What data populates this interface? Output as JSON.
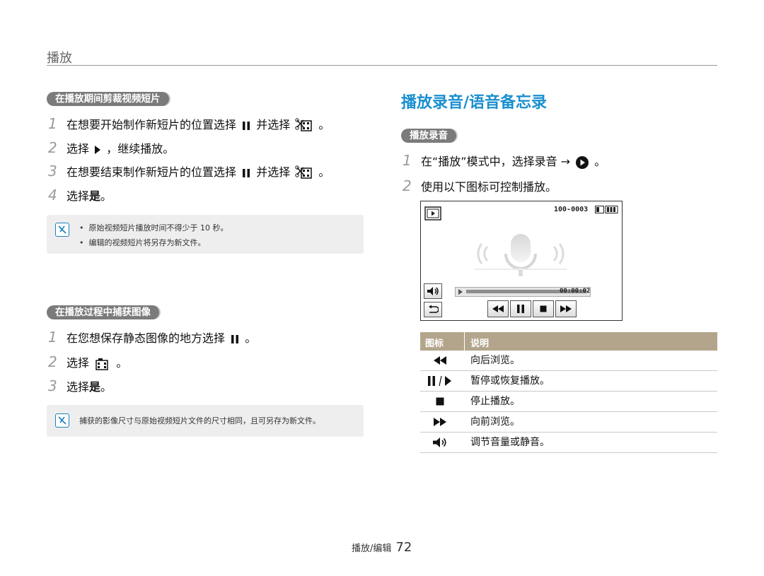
{
  "header": {
    "section": "播放"
  },
  "left": {
    "trim": {
      "pill": "在播放期间剪裁视频短片",
      "steps": [
        {
          "n": "1",
          "before": "在想要开始制作新短片的位置选择",
          "mid": "并选择",
          "after": "。"
        },
        {
          "n": "2",
          "before": "选择",
          "after": "，继续播放。"
        },
        {
          "n": "3",
          "before": "在想要结束制作新短片的位置选择",
          "mid": "并选择",
          "after": "。"
        },
        {
          "n": "4",
          "before": "选择",
          "bold": "是",
          "after": "。"
        }
      ],
      "notes": [
        "原始视频短片播放时间不得少于 10 秒。",
        "编辑的视频短片将另存为新文件。"
      ]
    },
    "capture": {
      "pill": "在播放过程中捕获图像",
      "steps": [
        {
          "n": "1",
          "before": "在您想保存静态图像的地方选择",
          "after": "。"
        },
        {
          "n": "2",
          "before": "选择",
          "after": "。"
        },
        {
          "n": "3",
          "before": "选择",
          "bold": "是",
          "after": "。"
        }
      ],
      "note": "捕获的影像尺寸与原始视频短片文件的尺寸相同，且可另存为新文件。"
    }
  },
  "right": {
    "title": "播放录音/语音备忘录",
    "pill": "播放录音",
    "steps": [
      {
        "n": "1",
        "text": "在“播放”模式中，选择录音 →",
        "after": "。"
      },
      {
        "n": "2",
        "text": "使用以下图标可控制播放。"
      }
    ],
    "screen": {
      "file": "100-0003",
      "time": "00:00:02"
    },
    "table": {
      "headers": [
        "图标",
        "说明"
      ],
      "rows": [
        {
          "icon": "rewind-icon",
          "desc": "向后浏览。"
        },
        {
          "icon": "pause-play-icon",
          "desc": "暂停或恢复播放。"
        },
        {
          "icon": "stop-icon",
          "desc": "停止播放。"
        },
        {
          "icon": "fast-forward-icon",
          "desc": "向前浏览。"
        },
        {
          "icon": "volume-icon",
          "desc": "调节音量或静音。"
        }
      ]
    }
  },
  "footer": {
    "label": "播放/编辑",
    "page": "72"
  },
  "colors": {
    "accent_blue": "#1a8fd0",
    "pill_gray": "#7b7b7b",
    "table_head": "#b3a58b",
    "note_bg": "#eeeeee"
  }
}
